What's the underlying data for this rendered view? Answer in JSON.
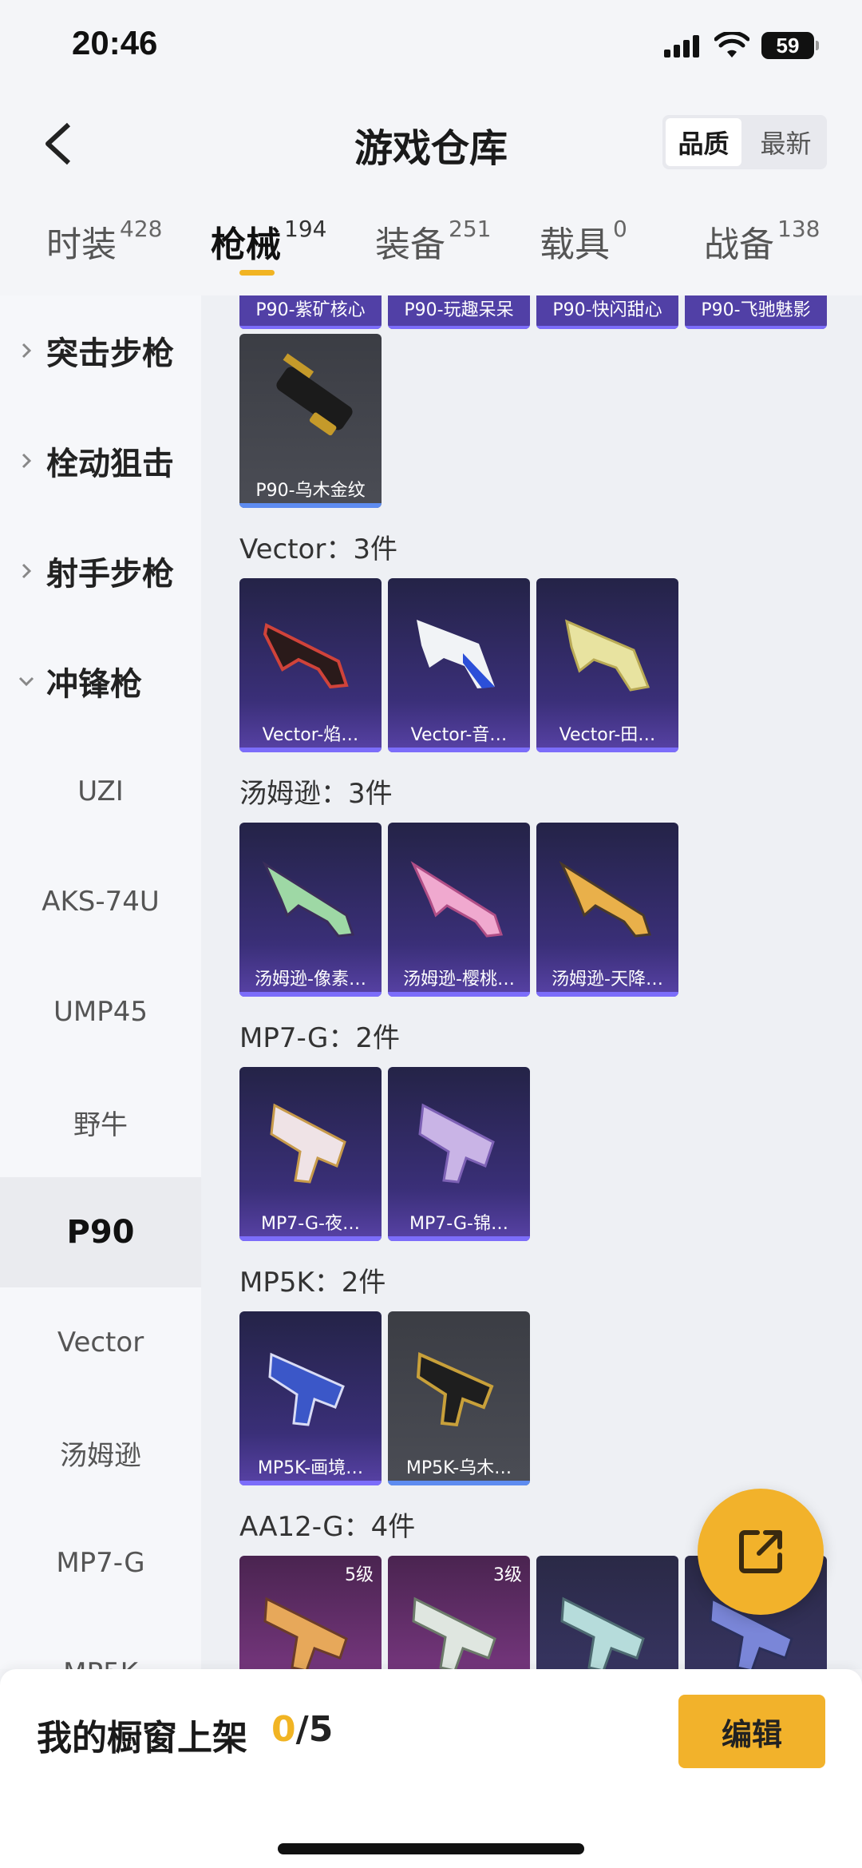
{
  "status": {
    "time": "20:46",
    "battery": "59"
  },
  "header": {
    "title": "游戏仓库",
    "sort_options": [
      "品质",
      "最新"
    ]
  },
  "tabs": [
    {
      "label": "时装",
      "count": "428"
    },
    {
      "label": "枪械",
      "count": "194"
    },
    {
      "label": "装备",
      "count": "251"
    },
    {
      "label": "载具",
      "count": "0"
    },
    {
      "label": "战备",
      "count": "138"
    }
  ],
  "sidebar": {
    "groups": [
      "突击步枪",
      "栓动狙击",
      "射手步枪",
      "冲锋枪"
    ],
    "items": [
      "UZI",
      "AKS-74U",
      "UMP45",
      "野牛",
      "P90",
      "Vector",
      "汤姆逊",
      "MP7-G",
      "MP5K"
    ]
  },
  "content": {
    "p90_top": [
      "P90-紫矿核心",
      "P90-玩趣呆呆",
      "P90-快闪甜心",
      "P90-飞驰魅影"
    ],
    "p90_card": "P90-乌木金纹",
    "sections": [
      {
        "title": "Vector：3件",
        "items": [
          "Vector-焰…",
          "Vector-音…",
          "Vector-田…"
        ]
      },
      {
        "title": "汤姆逊：3件",
        "items": [
          "汤姆逊-像素…",
          "汤姆逊-樱桃…",
          "汤姆逊-天降…"
        ]
      },
      {
        "title": "MP7-G：2件",
        "items": [
          "MP7-G-夜…",
          "MP7-G-锦…"
        ]
      },
      {
        "title": "MP5K：2件",
        "items": [
          "MP5K-画境…",
          "MP5K-乌木…"
        ]
      },
      {
        "title": "AA12-G：4件",
        "levels": [
          "5级",
          "3级"
        ]
      }
    ]
  },
  "bottom": {
    "showcase_label": "我的橱窗上架",
    "showcase_current": "0",
    "showcase_total": "/5",
    "edit_label": "编辑"
  },
  "colors": {
    "accent": "#f2b22b",
    "purple_card": "#3a2f78",
    "gray_card": "#4b4d55"
  }
}
